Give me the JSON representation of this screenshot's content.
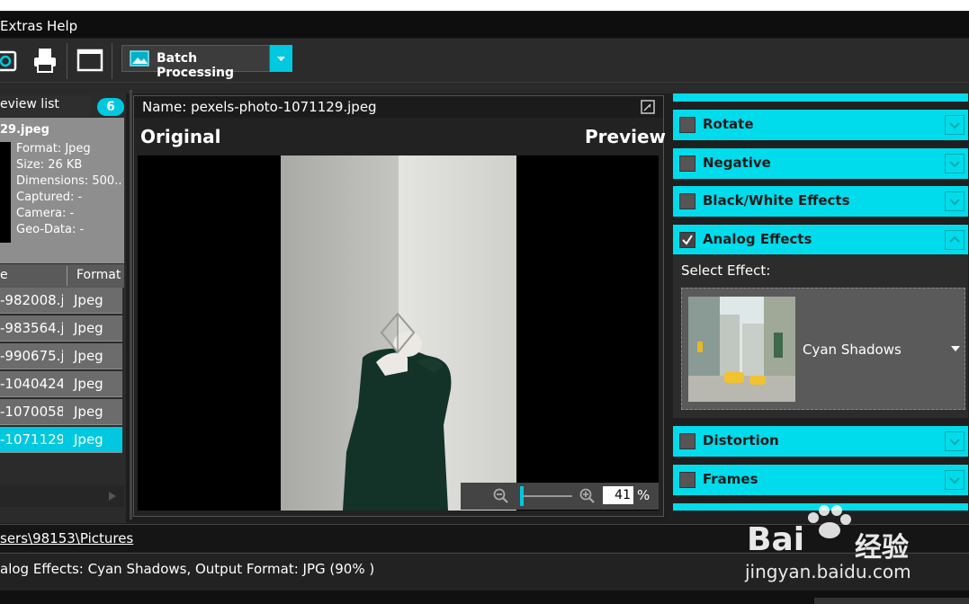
{
  "menu": {
    "extras": "Extras",
    "help": "Help"
  },
  "toolbar": {
    "batch_label": "Batch Processing"
  },
  "preview_list": {
    "tab_label": "eview list",
    "count": "6",
    "selected_file": "29.jpeg",
    "meta": [
      "Format: Jpeg",
      "Size: 26 KB",
      "Dimensions: 500...",
      "Captured: -",
      "Camera: -",
      "Geo-Data: -"
    ],
    "columns": [
      "e",
      "Format"
    ],
    "rows": [
      {
        "name": "-982008.j",
        "format": "Jpeg"
      },
      {
        "name": "-983564.j",
        "format": "Jpeg"
      },
      {
        "name": "-990675.j",
        "format": "Jpeg"
      },
      {
        "name": "-1040424",
        "format": "Jpeg"
      },
      {
        "name": "-1070058",
        "format": "Jpeg"
      },
      {
        "name": "-1071129",
        "format": "Jpeg"
      }
    ]
  },
  "viewer": {
    "name_label": "Name: pexels-photo-1071129.jpeg",
    "original_label": "Original",
    "preview_label": "Preview",
    "zoom_value": "41",
    "zoom_unit": "%"
  },
  "effects": {
    "sections": {
      "rotate": "Rotate",
      "negative": "Negative",
      "bw": "Black/White Effects",
      "analog": "Analog Effects",
      "distortion": "Distortion",
      "frames": "Frames"
    },
    "select_label": "Select Effect:",
    "selected_effect": "Cyan Shadows",
    "accent": "#00dcec"
  },
  "status": {
    "path": "sers\\98153\\Pictures",
    "summary": "alog Effects: Cyan Shadows, Output Format: JPG (90% )"
  },
  "watermark": {
    "brand": "Bai",
    "brand2": "经验",
    "url": "jingyan.baidu.com"
  }
}
